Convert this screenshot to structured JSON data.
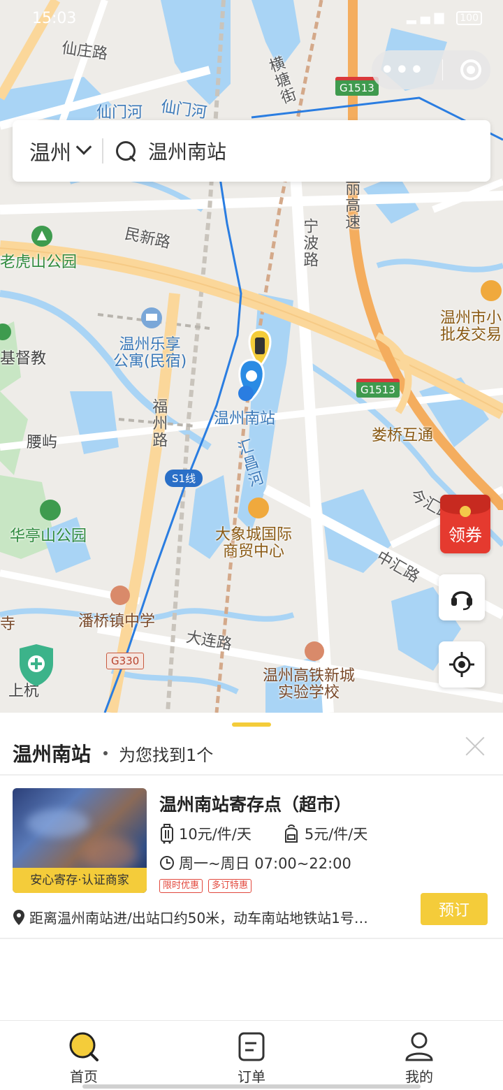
{
  "status_bar": {
    "time": "15:03",
    "battery": "100"
  },
  "search": {
    "city": "温州",
    "query": "温州南站"
  },
  "map": {
    "labels": {
      "xianzhuang_road": "仙庄路",
      "xianmen_river_1": "仙门河",
      "xianmen_river_2": "仙门河",
      "hengtang_street": "横塘街",
      "minxin_road": "民新路",
      "ningbo_road": "宁波路",
      "lishui_expressway": "丽高速",
      "laohushan_park": "老虎山公园",
      "jidujiao": "基督教",
      "lexiang_apartment": "温州乐享\n公寓(民宿)",
      "wenzhou_south_station": "温州南站",
      "fuzhou_road": "福州路",
      "yaoyu": "腰屿",
      "huichang_river": "汇昌河",
      "louqiao_interchange": "娄桥互通",
      "market_right": "温州市小\n批发交易",
      "jinhui_road": "今汇路",
      "zhonghui_road": "中汇路",
      "huatingshan_park": "华亭山公园",
      "daxiangcheng": "大象城国际\n商贸中心",
      "panqiao_school": "潘桥镇中学",
      "si": "寺",
      "dalian_road": "大连路",
      "hs_school": "温州高铁新城\n实验学校",
      "shanghang": "上杭"
    },
    "signs": {
      "g1513_top": "G1513",
      "g1513_mid": "G1513",
      "s1": "S1线",
      "g330": "G330"
    },
    "coupon": "领券"
  },
  "sheet": {
    "title": "温州南站",
    "result_text": "为您找到1个",
    "card": {
      "name": "温州南站寄存点（超市）",
      "badge": "安心寄存·认证商家",
      "price_luggage": "10元/件/天",
      "price_bag": "5元/件/天",
      "hours": "周一~周日 07:00~22:00",
      "tags": [
        "限时优惠",
        "多订特惠"
      ],
      "address": "距离温州南站进/出站口约50米，动车南站地铁站1号…",
      "book_label": "预订"
    }
  },
  "tabbar": {
    "home": "首页",
    "orders": "订单",
    "mine": "我的"
  },
  "colors": {
    "accent": "#f4cc3a",
    "water": "#a9d4f5",
    "road": "#fbd79a"
  }
}
